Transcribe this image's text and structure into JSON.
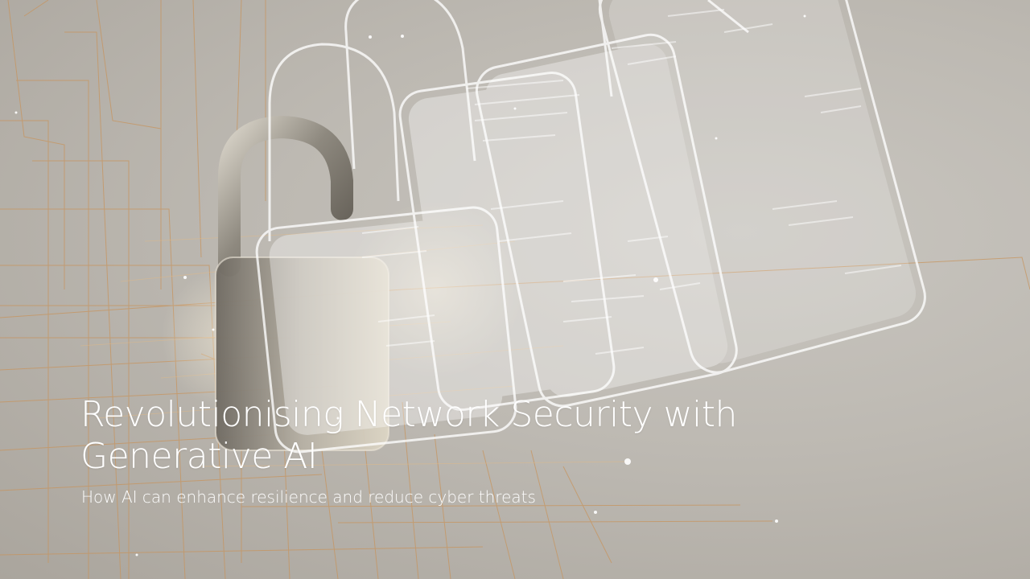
{
  "slide": {
    "title": "Revolutionising Network Security with\nGenerative AI",
    "subtitle": "How AI can enhance resilience and reduce cyber threats"
  },
  "background": {
    "image_subject": "padlock-with-digital-circuits",
    "colors": {
      "base": "#bdb9b2",
      "wire": "#c8955f",
      "glass": "#ffffff",
      "metal": "#8f8a82"
    }
  }
}
